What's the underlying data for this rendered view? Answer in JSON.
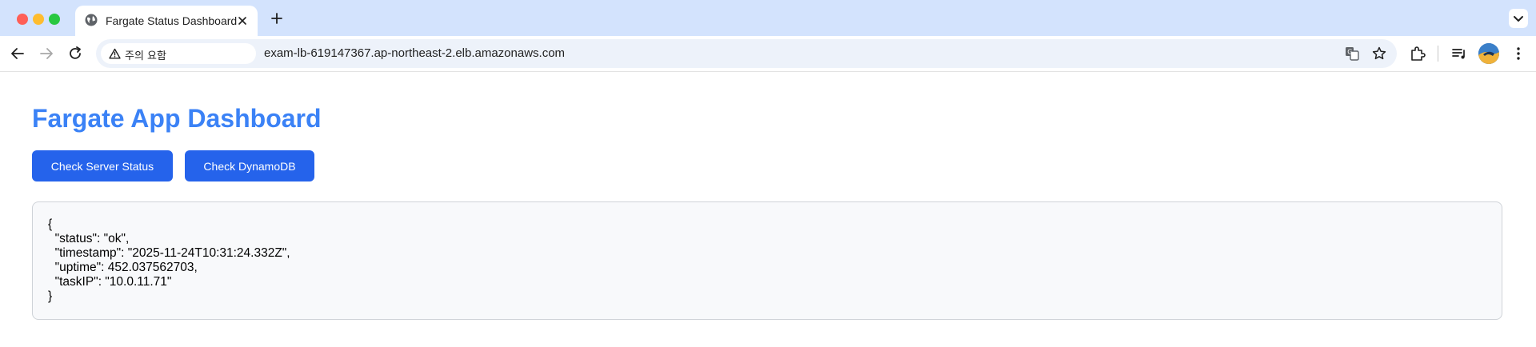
{
  "browser": {
    "tab_title": "Fargate Status Dashboard",
    "security_chip": "주의 요함",
    "url": "exam-lb-619147367.ap-northeast-2.elb.amazonaws.com",
    "icons": {
      "favicon": "globe-icon",
      "tab_close": "close-icon",
      "new_tab": "plus-icon",
      "tab_search": "chevron-down-icon",
      "back": "arrow-left-icon",
      "forward": "arrow-right-icon",
      "reload": "reload-icon",
      "warning": "warning-triangle-icon",
      "translate": "translate-icon",
      "bookmark": "star-icon",
      "extensions": "puzzle-icon",
      "media": "media-queue-icon",
      "profile": "avatar",
      "menu": "kebab-menu-icon"
    }
  },
  "page": {
    "title": "Fargate App Dashboard",
    "title_color": "#3b82f6",
    "buttons": {
      "server_status": "Check Server Status",
      "dynamodb": "Check DynamoDB",
      "color": "#2563eb"
    },
    "output": "{\n  \"status\": \"ok\",\n  \"timestamp\": \"2025-11-24T10:31:24.332Z\",\n  \"uptime\": 452.037562703,\n  \"taskIP\": \"10.0.11.71\"\n}"
  }
}
